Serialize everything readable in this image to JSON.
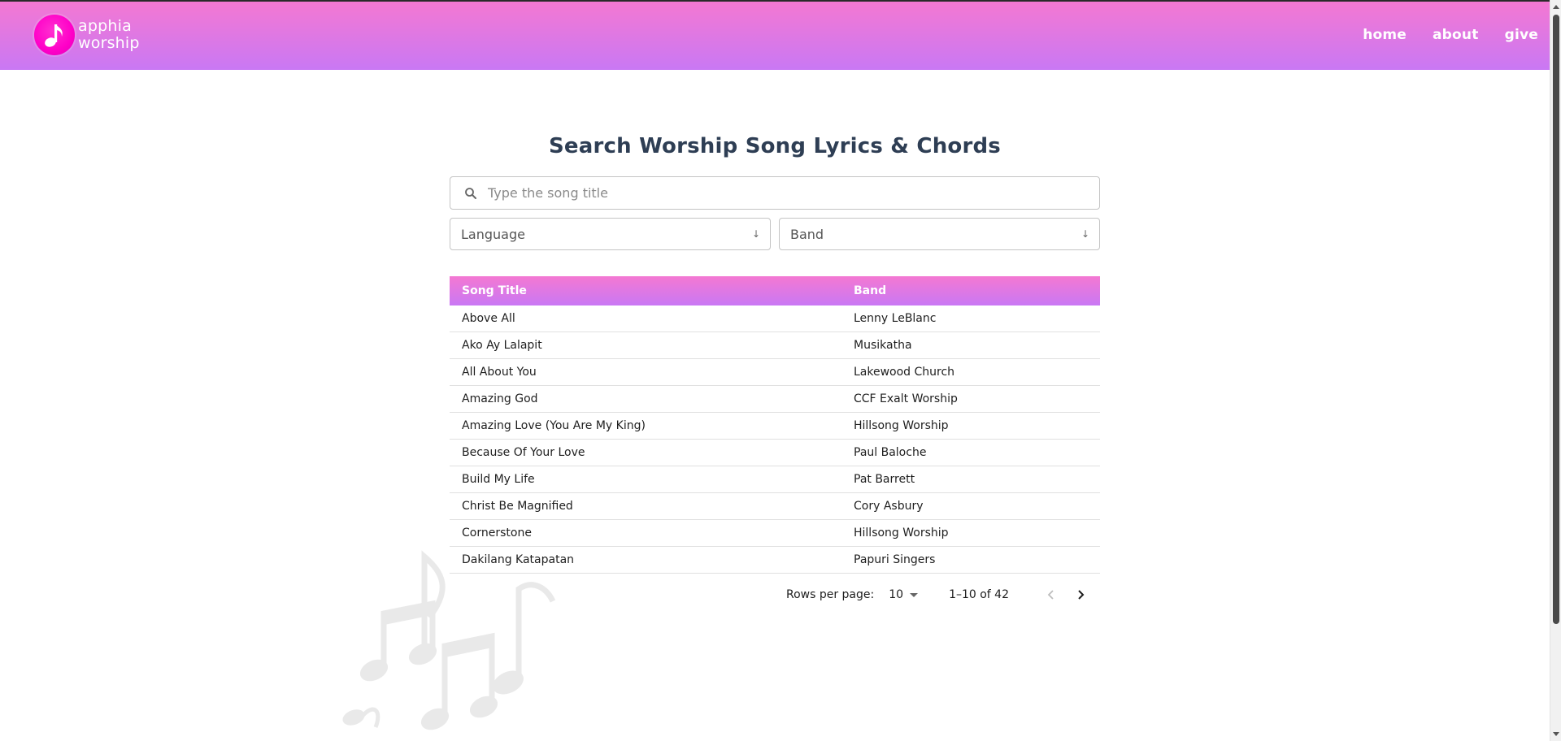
{
  "brand": {
    "line1": "apphia",
    "line2": "worship"
  },
  "nav": {
    "home": "home",
    "about": "about",
    "give": "give"
  },
  "page": {
    "title": "Search Worship Song Lyrics & Chords"
  },
  "search": {
    "placeholder": "Type the song title",
    "value": ""
  },
  "filters": {
    "language_label": "Language",
    "band_label": "Band"
  },
  "table": {
    "headers": {
      "song_title": "Song Title",
      "band": "Band"
    },
    "rows": [
      {
        "title": "Above All",
        "band": "Lenny LeBlanc"
      },
      {
        "title": "Ako Ay Lalapit",
        "band": "Musikatha"
      },
      {
        "title": "All About You",
        "band": "Lakewood Church"
      },
      {
        "title": "Amazing God",
        "band": "CCF Exalt Worship"
      },
      {
        "title": "Amazing Love (You Are My King)",
        "band": "Hillsong Worship"
      },
      {
        "title": "Because Of Your Love",
        "band": "Paul Baloche"
      },
      {
        "title": "Build My Life",
        "band": "Pat Barrett"
      },
      {
        "title": "Christ Be Magnified",
        "band": "Cory Asbury"
      },
      {
        "title": "Cornerstone",
        "band": "Hillsong Worship"
      },
      {
        "title": "Dakilang Katapatan",
        "band": "Papuri Singers"
      }
    ]
  },
  "pagination": {
    "rows_per_page_label": "Rows per page:",
    "rows_per_page_value": "10",
    "range_text": "1–10 of 42"
  },
  "icons": {
    "logo": "music-note-icon",
    "search": "search-icon",
    "select_arrow": "arrow-down-icon",
    "prev": "chevron-left-icon",
    "next": "chevron-right-icon",
    "decoration": "music-notes-icon"
  },
  "colors": {
    "header_gradient_top": "#f478d2",
    "header_gradient_bottom": "#c978f4",
    "logo_bg": "#ff00c8",
    "title_text": "#2e3e54"
  }
}
